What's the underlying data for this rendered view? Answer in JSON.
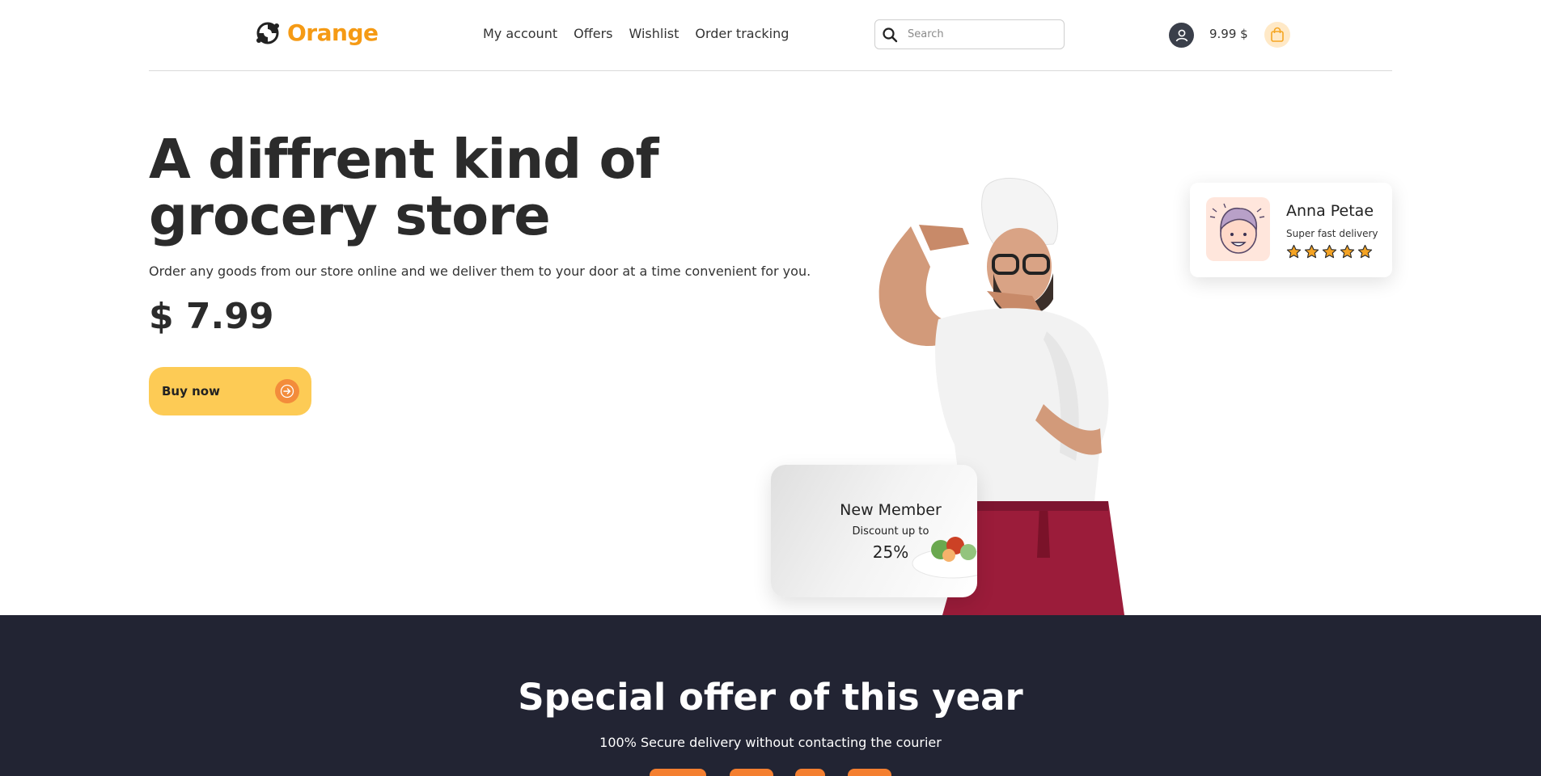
{
  "header": {
    "logo_text": "Orange",
    "nav": [
      "My account",
      "Offers",
      "Wishlist",
      "Order tracking"
    ],
    "search_placeholder": "Search",
    "cart_total": "9.99 $"
  },
  "hero": {
    "title_line1": "A diffrent kind of",
    "title_line2": "grocery store",
    "subtitle": "Order any goods from our store online and we deliver them to your door at a time convenient for you.",
    "price": "$ 7.99",
    "buy_label": "Buy now"
  },
  "review": {
    "name": "Anna Petae",
    "text": "Super fast delivery",
    "rating": 5
  },
  "member": {
    "title": "New Member",
    "subtitle": "Discount up to",
    "discount": "25%"
  },
  "special": {
    "title": "Special offer of this year",
    "subtitle": "100% Secure delivery without contacting the courier"
  },
  "colors": {
    "brand": "#f59a14",
    "button": "#fdcb55",
    "accent": "#f38c3b",
    "dark_section": "#222433",
    "star": "#f4a324"
  }
}
